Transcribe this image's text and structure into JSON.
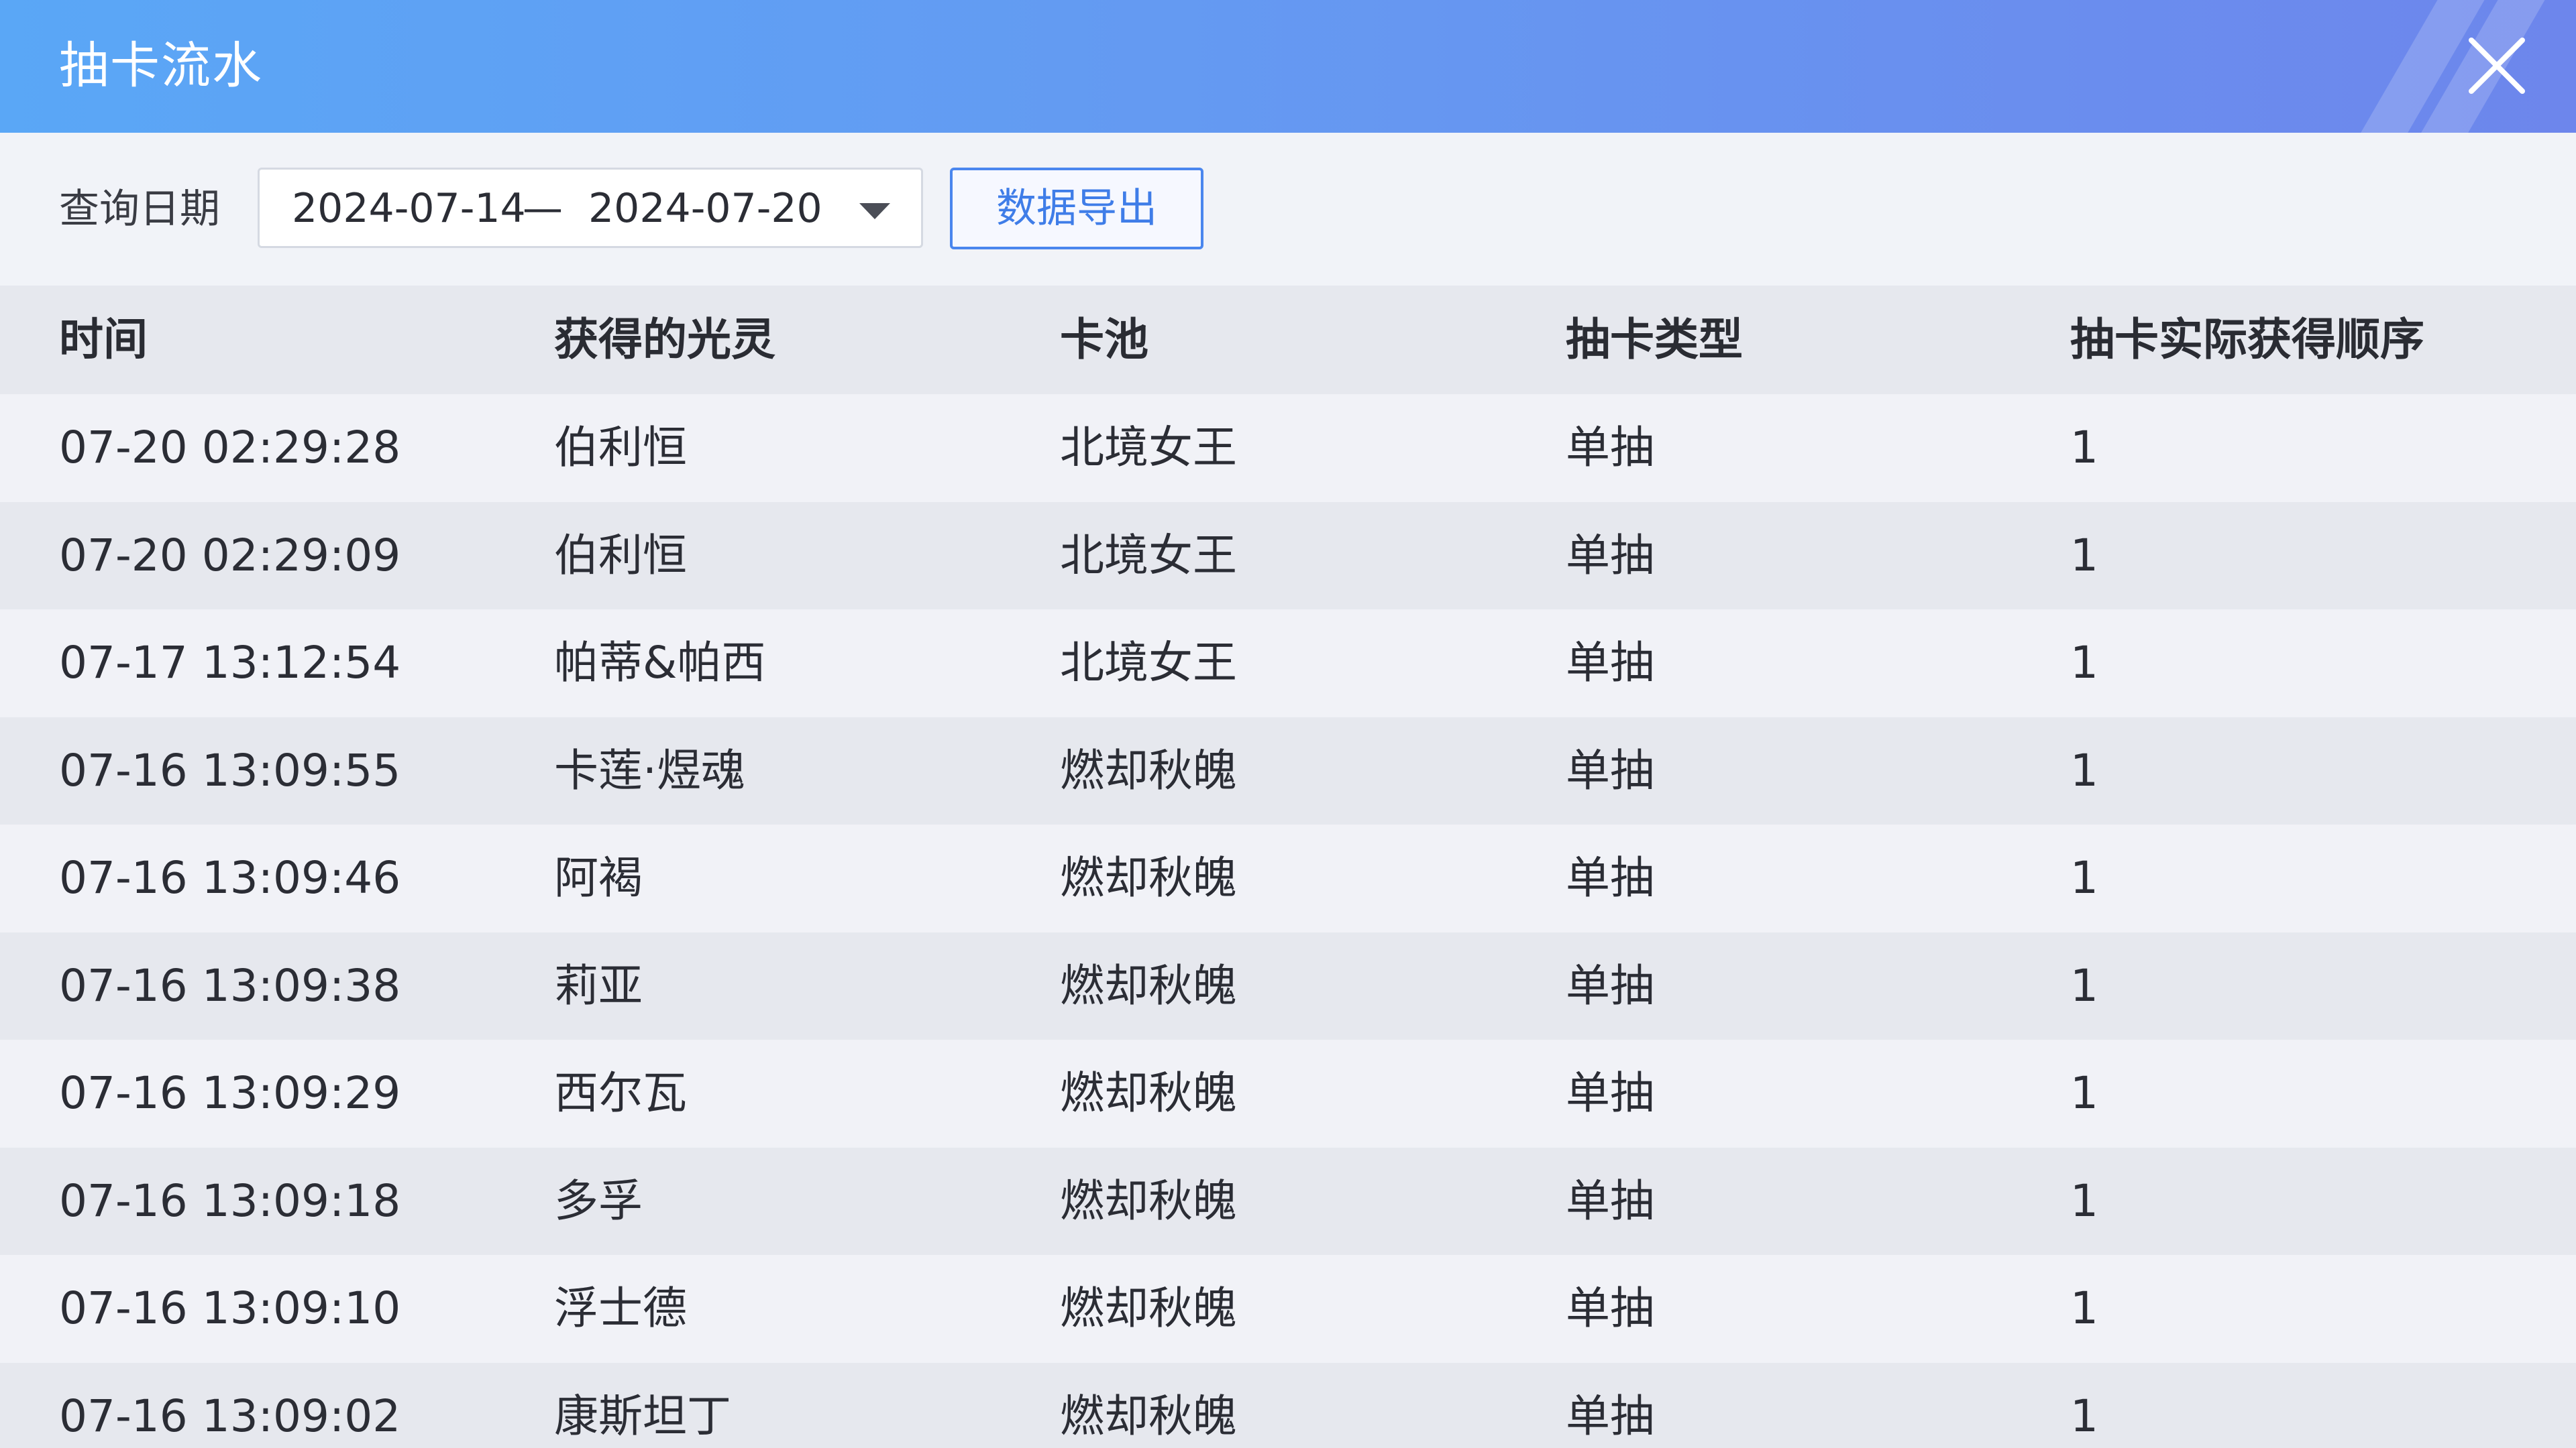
{
  "header": {
    "title": "抽卡流水",
    "close_icon": "close-icon"
  },
  "filter": {
    "label": "查询日期",
    "start_date": "2024-07-14",
    "separator": "—",
    "end_date": "2024-07-20",
    "export_label": "数据导出"
  },
  "table": {
    "columns": [
      "时间",
      "获得的光灵",
      "卡池",
      "抽卡类型",
      "抽卡实际获得顺序"
    ],
    "rows": [
      [
        "07-20 02:29:28",
        "伯利恒",
        "北境女王",
        "单抽",
        "1"
      ],
      [
        "07-20 02:29:09",
        "伯利恒",
        "北境女王",
        "单抽",
        "1"
      ],
      [
        "07-17 13:12:54",
        "帕蒂&帕西",
        "北境女王",
        "单抽",
        "1"
      ],
      [
        "07-16 13:09:55",
        "卡莲·煜魂",
        "燃却秋魄",
        "单抽",
        "1"
      ],
      [
        "07-16 13:09:46",
        "阿褐",
        "燃却秋魄",
        "单抽",
        "1"
      ],
      [
        "07-16 13:09:38",
        "莉亚",
        "燃却秋魄",
        "单抽",
        "1"
      ],
      [
        "07-16 13:09:29",
        "西尔瓦",
        "燃却秋魄",
        "单抽",
        "1"
      ],
      [
        "07-16 13:09:18",
        "多孚",
        "燃却秋魄",
        "单抽",
        "1"
      ],
      [
        "07-16 13:09:10",
        "浮士德",
        "燃却秋魄",
        "单抽",
        "1"
      ],
      [
        "07-16 13:09:02",
        "康斯坦丁",
        "燃却秋魄",
        "单抽",
        "1"
      ]
    ]
  },
  "colors": {
    "header_gradient_start": "#5aa7f6",
    "header_gradient_end": "#6d86ec",
    "accent": "#4a86ee",
    "row_light": "#f1f2f7",
    "row_dark": "#e6e8ee"
  }
}
